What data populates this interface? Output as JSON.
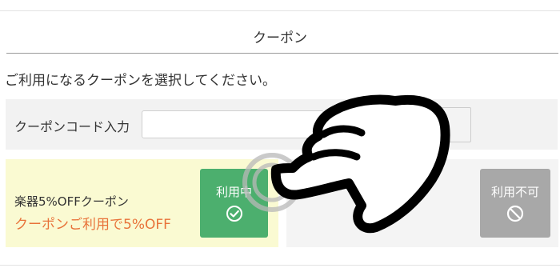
{
  "header": {
    "title": "クーポン"
  },
  "instruction": "ご利用になるクーポンを選択してください。",
  "coupon_code": {
    "label": "クーポンコード入力",
    "value": "",
    "placeholder": ""
  },
  "coupons": [
    {
      "name": "楽器5%OFFクーポン",
      "description": "クーポンご利用で5%OFF",
      "button_label": "利用中",
      "button_icon": "check-circle-icon",
      "status": "in-use"
    },
    {
      "name": "",
      "description": "",
      "button_label": "利用不可",
      "button_icon": "prohibited-icon",
      "status": "unavailable"
    }
  ],
  "colors": {
    "in_use_button": "#4caf6e",
    "unavailable_button": "#a8a8a8",
    "discount_text": "#e8733a",
    "selected_coupon_bg": "#fafad2"
  },
  "overlay_icons": [
    "pointing-hand-icon",
    "tap-ripple-icon"
  ]
}
